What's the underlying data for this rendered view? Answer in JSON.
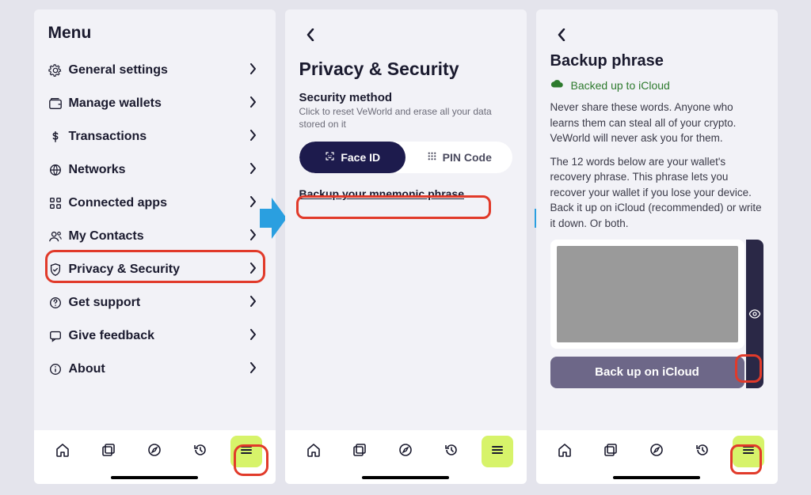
{
  "screen1": {
    "title": "Menu",
    "items": [
      {
        "icon": "gear",
        "label": "General settings"
      },
      {
        "icon": "wallet",
        "label": "Manage wallets"
      },
      {
        "icon": "dollar",
        "label": "Transactions"
      },
      {
        "icon": "globe",
        "label": "Networks"
      },
      {
        "icon": "apps",
        "label": "Connected apps"
      },
      {
        "icon": "contacts",
        "label": "My Contacts"
      },
      {
        "icon": "shield",
        "label": "Privacy & Security"
      },
      {
        "icon": "help",
        "label": "Get support"
      },
      {
        "icon": "chat",
        "label": "Give feedback"
      },
      {
        "icon": "info",
        "label": "About"
      }
    ]
  },
  "screen2": {
    "title": "Privacy & Security",
    "section_title": "Security method",
    "section_sub": "Click to reset VeWorld and erase all your data stored on it",
    "seg_active": "Face ID",
    "seg_inactive": "PIN Code",
    "backup_link": "Backup your mnemonic phrase"
  },
  "screen3": {
    "title": "Backup phrase",
    "status": "Backed up to iCloud",
    "body1": "Never share these words. Anyone who learns them can steal all of your crypto.\nVeWorld will never ask you for them.",
    "body2": "The 12 words below are your wallet's recovery phrase. This phrase lets you recover your wallet if you lose your device. Back it up on iCloud (recommended) or write it down. Or both.",
    "backup_btn": "Back up on iCloud"
  },
  "nav_icons": [
    "home",
    "gallery",
    "compass",
    "history",
    "menu"
  ]
}
